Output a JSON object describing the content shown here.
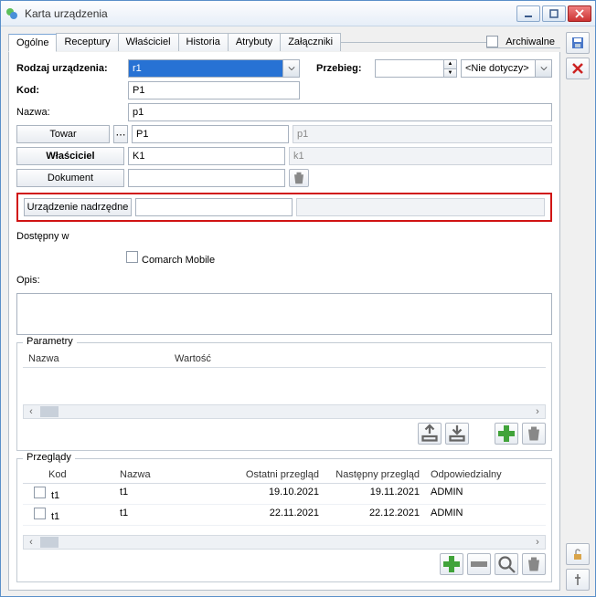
{
  "window": {
    "title": "Karta urządzenia"
  },
  "tabs": [
    "Ogólne",
    "Receptury",
    "Właściciel",
    "Historia",
    "Atrybuty",
    "Załączniki"
  ],
  "archival_label": "Archiwalne",
  "labels": {
    "rodzaj": "Rodzaj urządzenia:",
    "kod": "Kod:",
    "nazwa": "Nazwa:",
    "towar": "Towar",
    "wlasciciel": "Właściciel",
    "dokument": "Dokument",
    "urz_nadrz": "Urządzenie nadrzędne",
    "dostepny": "Dostępny w",
    "comarch": "Comarch Mobile",
    "opis": "Opis:",
    "parametry": "Parametry",
    "przeglady": "Przeglądy",
    "przebieg": "Przebieg:",
    "nie_dotyczy": "<Nie dotyczy>"
  },
  "values": {
    "rodzaj": "r1",
    "kod": "P1",
    "nazwa": "p1",
    "towar_kod": "P1",
    "towar_nazwa": "p1",
    "wlasc_kod": "K1",
    "wlasc_nazwa": "k1",
    "przebieg": ""
  },
  "param_cols": [
    "Nazwa",
    "Wartość"
  ],
  "przeglad_cols": [
    "Kod",
    "Nazwa",
    "Ostatni przegląd",
    "Następny przegląd",
    "Odpowiedzialny"
  ],
  "przeglady": [
    {
      "kod": "t1",
      "nazwa": "t1",
      "ost": "19.10.2021",
      "nast": "19.11.2021",
      "odp": "ADMIN"
    },
    {
      "kod": "t1",
      "nazwa": "t1",
      "ost": "22.11.2021",
      "nast": "22.12.2021",
      "odp": "ADMIN"
    }
  ]
}
